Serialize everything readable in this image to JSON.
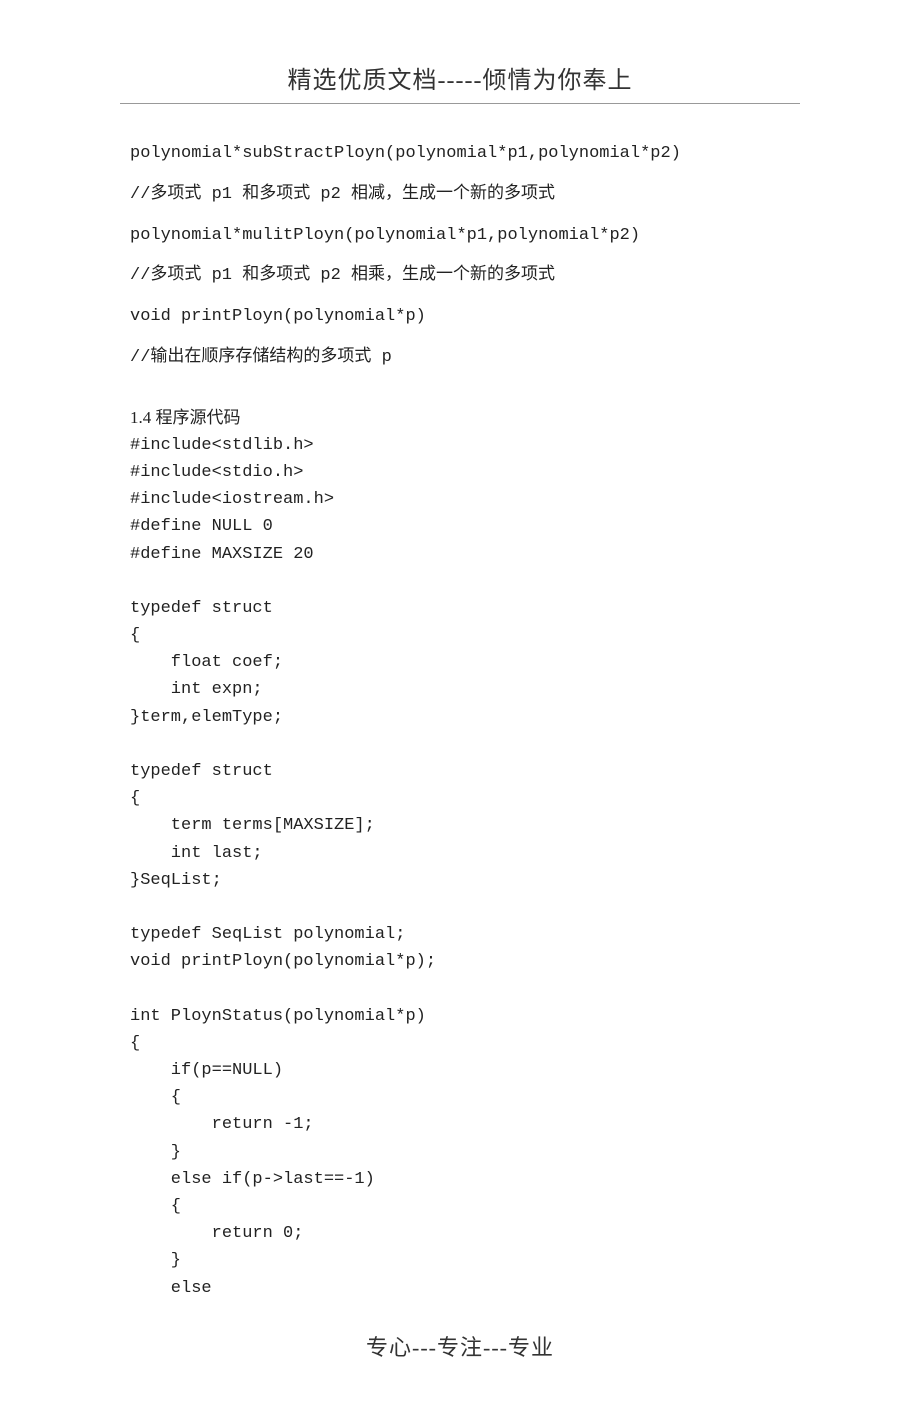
{
  "header": "精选优质文档-----倾情为你奉上",
  "prototypes": [
    "polynomial*subStractPloyn(polynomial*p1,polynomial*p2)",
    "//多项式 p1 和多项式 p2 相减，生成一个新的多项式",
    "polynomial*mulitPloyn(polynomial*p1,polynomial*p2)",
    "//多项式 p1 和多项式 p2 相乘，生成一个新的多项式",
    "void printPloyn(polynomial*p)",
    "//输出在顺序存储结构的多项式 p"
  ],
  "section_title": "1.4 程序源代码",
  "code": "#include<stdlib.h>\n#include<stdio.h>\n#include<iostream.h>\n#define NULL 0\n#define MAXSIZE 20\n\ntypedef struct\n{\n    float coef;\n    int expn;\n}term,elemType;\n\ntypedef struct\n{\n    term terms[MAXSIZE];\n    int last;\n}SeqList;\n\ntypedef SeqList polynomial;\nvoid printPloyn(polynomial*p);\n\nint PloynStatus(polynomial*p)\n{\n    if(p==NULL)\n    {\n        return -1;\n    }\n    else if(p->last==-1)\n    {\n        return 0;\n    }\n    else",
  "footer": "专心---专注---专业"
}
